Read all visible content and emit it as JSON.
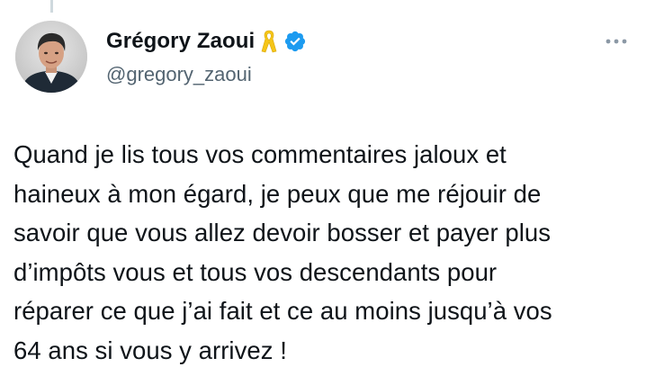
{
  "author": {
    "display_name": "Grégory Zaoui",
    "handle": "@gregory_zaoui",
    "badges": [
      "yellow-ribbon-icon",
      "verified-badge-icon"
    ],
    "verified_color": "#1d9bf0",
    "ribbon_color": "#f5c518"
  },
  "menu": {
    "icon": "more-options-icon"
  },
  "tweet": {
    "text": "Quand je lis tous vos commentaires jaloux et\nhaineux à mon égard, je peux que me réjouir de\nsavoir que vous allez devoir bosser et payer plus\nd’impôts vous et tous vos descendants pour\nréparer ce que j’ai fait et ce au moins jusqu’à vos\n64 ans si vous y arrivez !"
  }
}
